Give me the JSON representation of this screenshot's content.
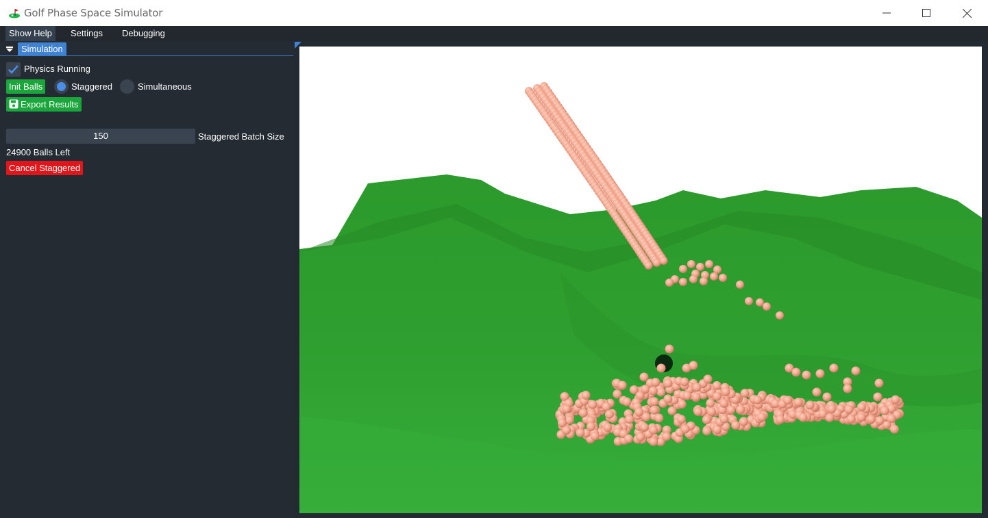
{
  "window": {
    "title": "Golf Phase Space Simulator",
    "icon": "golf-flag-icon",
    "controls": [
      "minimize-icon",
      "maximize-icon",
      "close-icon"
    ]
  },
  "menu": {
    "items": [
      {
        "label": "Show Help"
      },
      {
        "label": "Settings"
      },
      {
        "label": "Debugging"
      }
    ]
  },
  "panel": {
    "tab_label": "Simulation",
    "physics_checkbox": {
      "label": "Physics Running",
      "checked": true
    },
    "init_button": "Init Balls",
    "mode_radios": [
      {
        "label": "Staggered",
        "selected": true
      },
      {
        "label": "Simultaneous",
        "selected": false
      }
    ],
    "export_button": "Export Results",
    "batch_slider": {
      "value": "150",
      "label": "Staggered Batch Size"
    },
    "balls_left": "24900 Balls Left",
    "cancel_button": "Cancel Staggered"
  },
  "colors": {
    "panel_bg": "#252b33",
    "accent_blue": "#3f82d2",
    "button_green": "#1aa63a",
    "button_red": "#e0161b",
    "terrain_green": "#2d9a2d",
    "ball_color": "#f2a48c"
  }
}
